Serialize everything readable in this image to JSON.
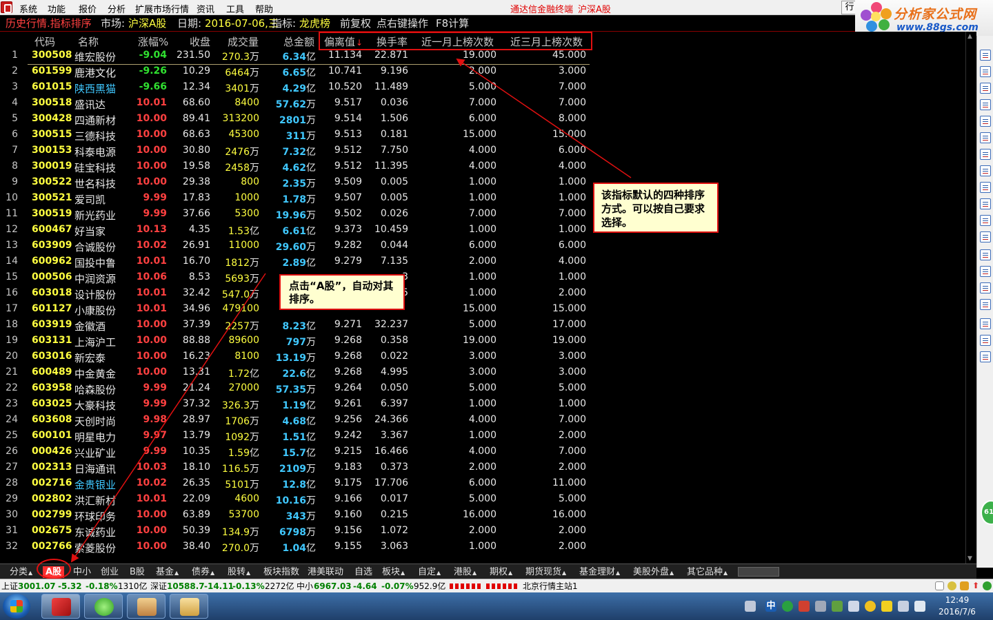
{
  "menu": {
    "items": [
      "系统",
      "功能",
      "报价",
      "分析",
      "扩展市场行情",
      "资讯",
      "工具",
      "帮助"
    ],
    "right_links": [
      "通达信金融终端",
      "沪深A股"
    ],
    "button_label": "行"
  },
  "logo": {
    "title": "分析家公式网",
    "url": "www.88gs.com"
  },
  "titlebar": {
    "page": "历史行情.指标排序",
    "market_label": "市场:",
    "market": "沪深A股",
    "date_label": "日期:",
    "date": "2016-07-06,三",
    "indicator_label": "指标:",
    "indicator": "龙虎榜",
    "adjust": "前复权",
    "right_click": "点右键操作",
    "f8": "F8计算"
  },
  "table": {
    "headers": {
      "code": "代码",
      "name": "名称",
      "change": "涨幅%",
      "close": "收盘",
      "volume": "成交量",
      "amount": "总金额",
      "deviation": "偏离值",
      "sort_arrow": "↓",
      "turnover": "换手率",
      "month1": "近一月上榜次数",
      "month3": "近三月上榜次数"
    },
    "rows": [
      {
        "idx": "1",
        "code": "300508",
        "name": "维宏股份",
        "chg": "-9.04",
        "close": "231.50",
        "vol": "270.3",
        "vol_unit": "万",
        "amt": "6.34",
        "amt_unit": "亿",
        "dev": "11.134",
        "turn": "22.871",
        "m1": "19.000",
        "m3": "45.000"
      },
      {
        "idx": "2",
        "code": "601599",
        "name": "鹿港文化",
        "chg": "-9.26",
        "close": "10.29",
        "vol": "6464",
        "vol_unit": "万",
        "amt": "6.65",
        "amt_unit": "亿",
        "dev": "10.741",
        "turn": "9.196",
        "m1": "2.000",
        "m3": "3.000"
      },
      {
        "idx": "3",
        "code": "601015",
        "name": "陕西黑猫",
        "chg": "-9.66",
        "close": "12.34",
        "vol": "3401",
        "vol_unit": "万",
        "amt": "4.29",
        "amt_unit": "亿",
        "dev": "10.520",
        "turn": "11.489",
        "m1": "5.000",
        "m3": "7.000"
      },
      {
        "idx": "4",
        "code": "300518",
        "name": "盛讯达",
        "chg": "10.01",
        "close": "68.60",
        "vol": "8400",
        "vol_unit": "",
        "amt": "57.62",
        "amt_unit": "万",
        "dev": "9.517",
        "turn": "0.036",
        "m1": "7.000",
        "m3": "7.000"
      },
      {
        "idx": "5",
        "code": "300428",
        "name": "四通新材",
        "chg": "10.00",
        "close": "89.41",
        "vol": "313200",
        "vol_unit": "",
        "amt": "2801",
        "amt_unit": "万",
        "dev": "9.514",
        "turn": "1.506",
        "m1": "6.000",
        "m3": "8.000"
      },
      {
        "idx": "6",
        "code": "300515",
        "name": "三德科技",
        "chg": "10.00",
        "close": "68.63",
        "vol": "45300",
        "vol_unit": "",
        "amt": "311",
        "amt_unit": "万",
        "dev": "9.513",
        "turn": "0.181",
        "m1": "15.000",
        "m3": "15.000"
      },
      {
        "idx": "7",
        "code": "300153",
        "name": "科泰电源",
        "chg": "10.00",
        "close": "30.80",
        "vol": "2476",
        "vol_unit": "万",
        "amt": "7.32",
        "amt_unit": "亿",
        "dev": "9.512",
        "turn": "7.750",
        "m1": "4.000",
        "m3": "6.000"
      },
      {
        "idx": "8",
        "code": "300019",
        "name": "硅宝科技",
        "chg": "10.00",
        "close": "19.58",
        "vol": "2458",
        "vol_unit": "万",
        "amt": "4.62",
        "amt_unit": "亿",
        "dev": "9.512",
        "turn": "11.395",
        "m1": "4.000",
        "m3": "4.000"
      },
      {
        "idx": "9",
        "code": "300522",
        "name": "世名科技",
        "chg": "10.00",
        "close": "29.38",
        "vol": "800",
        "vol_unit": "",
        "amt": "2.35",
        "amt_unit": "万",
        "dev": "9.509",
        "turn": "0.005",
        "m1": "1.000",
        "m3": "1.000"
      },
      {
        "idx": "10",
        "code": "300521",
        "name": "爱司凯",
        "chg": "9.99",
        "close": "17.83",
        "vol": "1000",
        "vol_unit": "",
        "amt": "1.78",
        "amt_unit": "万",
        "dev": "9.507",
        "turn": "0.005",
        "m1": "1.000",
        "m3": "1.000"
      },
      {
        "idx": "11",
        "code": "300519",
        "name": "新光药业",
        "chg": "9.99",
        "close": "37.66",
        "vol": "5300",
        "vol_unit": "",
        "amt": "19.96",
        "amt_unit": "万",
        "dev": "9.502",
        "turn": "0.026",
        "m1": "7.000",
        "m3": "7.000"
      },
      {
        "idx": "12",
        "code": "600467",
        "name": "好当家",
        "chg": "10.13",
        "close": "4.35",
        "vol": "1.53",
        "vol_unit": "亿",
        "amt": "6.61",
        "amt_unit": "亿",
        "dev": "9.373",
        "turn": "10.459",
        "m1": "1.000",
        "m3": "1.000"
      },
      {
        "idx": "13",
        "code": "603909",
        "name": "合诚股份",
        "chg": "10.02",
        "close": "26.91",
        "vol": "11000",
        "vol_unit": "",
        "amt": "29.60",
        "amt_unit": "万",
        "dev": "9.282",
        "turn": "0.044",
        "m1": "6.000",
        "m3": "6.000"
      },
      {
        "idx": "14",
        "code": "600962",
        "name": "国投中鲁",
        "chg": "10.01",
        "close": "16.70",
        "vol": "1812",
        "vol_unit": "万",
        "amt": "2.89",
        "amt_unit": "亿",
        "dev": "9.279",
        "turn": "7.135",
        "m1": "2.000",
        "m3": "4.000"
      },
      {
        "idx": "15",
        "code": "000506",
        "name": "中润资源",
        "chg": "10.06",
        "close": "8.53",
        "vol": "5693",
        "vol_unit": "万",
        "amt": "",
        "amt_unit": "",
        "dev": "",
        "turn": "3",
        "m1": "1.000",
        "m3": "1.000"
      },
      {
        "idx": "16",
        "code": "603018",
        "name": "设计股份",
        "chg": "10.01",
        "close": "32.42",
        "vol": "547.0",
        "vol_unit": "万",
        "amt": "",
        "amt_unit": "",
        "dev": "",
        "turn": "5",
        "m1": "1.000",
        "m3": "2.000"
      },
      {
        "idx": "17",
        "code": "601127",
        "name": "小康股份",
        "chg": "10.01",
        "close": "34.96",
        "vol": "479100",
        "vol_unit": "",
        "amt": "",
        "amt_unit": "",
        "dev": "",
        "turn": "",
        "m1": "15.000",
        "m3": "15.000"
      },
      {
        "idx": "18",
        "code": "603919",
        "name": "金徽酒",
        "chg": "10.00",
        "close": "37.39",
        "vol": "2257",
        "vol_unit": "万",
        "amt": "8.23",
        "amt_unit": "亿",
        "dev": "9.271",
        "turn": "32.237",
        "m1": "5.000",
        "m3": "17.000"
      },
      {
        "idx": "19",
        "code": "603131",
        "name": "上海沪工",
        "chg": "10.00",
        "close": "88.88",
        "vol": "89600",
        "vol_unit": "",
        "amt": "797",
        "amt_unit": "万",
        "dev": "9.268",
        "turn": "0.358",
        "m1": "19.000",
        "m3": "19.000"
      },
      {
        "idx": "20",
        "code": "603016",
        "name": "新宏泰",
        "chg": "10.00",
        "close": "16.23",
        "vol": "8100",
        "vol_unit": "",
        "amt": "13.19",
        "amt_unit": "万",
        "dev": "9.268",
        "turn": "0.022",
        "m1": "3.000",
        "m3": "3.000"
      },
      {
        "idx": "21",
        "code": "600489",
        "name": "中金黄金",
        "chg": "10.00",
        "close": "13.31",
        "vol": "1.72",
        "vol_unit": "亿",
        "amt": "22.6",
        "amt_unit": "亿",
        "dev": "9.268",
        "turn": "4.995",
        "m1": "3.000",
        "m3": "3.000"
      },
      {
        "idx": "22",
        "code": "603958",
        "name": "哈森股份",
        "chg": "9.99",
        "close": "21.24",
        "vol": "27000",
        "vol_unit": "",
        "amt": "57.35",
        "amt_unit": "万",
        "dev": "9.264",
        "turn": "0.050",
        "m1": "5.000",
        "m3": "5.000"
      },
      {
        "idx": "23",
        "code": "603025",
        "name": "大豪科技",
        "chg": "9.99",
        "close": "37.32",
        "vol": "326.3",
        "vol_unit": "万",
        "amt": "1.19",
        "amt_unit": "亿",
        "dev": "9.261",
        "turn": "6.397",
        "m1": "1.000",
        "m3": "1.000"
      },
      {
        "idx": "24",
        "code": "603608",
        "name": "天创时尚",
        "chg": "9.98",
        "close": "28.97",
        "vol": "1706",
        "vol_unit": "万",
        "amt": "4.68",
        "amt_unit": "亿",
        "dev": "9.256",
        "turn": "24.366",
        "m1": "4.000",
        "m3": "7.000"
      },
      {
        "idx": "25",
        "code": "600101",
        "name": "明星电力",
        "chg": "9.97",
        "close": "13.79",
        "vol": "1092",
        "vol_unit": "万",
        "amt": "1.51",
        "amt_unit": "亿",
        "dev": "9.242",
        "turn": "3.367",
        "m1": "1.000",
        "m3": "2.000"
      },
      {
        "idx": "26",
        "code": "000426",
        "name": "兴业矿业",
        "chg": "9.99",
        "close": "10.35",
        "vol": "1.59",
        "vol_unit": "亿",
        "amt": "15.7",
        "amt_unit": "亿",
        "dev": "9.215",
        "turn": "16.466",
        "m1": "4.000",
        "m3": "7.000"
      },
      {
        "idx": "27",
        "code": "002313",
        "name": "日海通讯",
        "chg": "10.03",
        "close": "18.10",
        "vol": "116.5",
        "vol_unit": "万",
        "amt": "2109",
        "amt_unit": "万",
        "dev": "9.183",
        "turn": "0.373",
        "m1": "2.000",
        "m3": "2.000"
      },
      {
        "idx": "28",
        "code": "002716",
        "name": "金贵银业",
        "chg": "10.02",
        "close": "26.35",
        "vol": "5101",
        "vol_unit": "万",
        "amt": "12.8",
        "amt_unit": "亿",
        "dev": "9.175",
        "turn": "17.706",
        "m1": "6.000",
        "m3": "11.000"
      },
      {
        "idx": "29",
        "code": "002802",
        "name": "洪汇新材",
        "chg": "10.01",
        "close": "22.09",
        "vol": "4600",
        "vol_unit": "",
        "amt": "10.16",
        "amt_unit": "万",
        "dev": "9.166",
        "turn": "0.017",
        "m1": "5.000",
        "m3": "5.000"
      },
      {
        "idx": "30",
        "code": "002799",
        "name": "环球印务",
        "chg": "10.00",
        "close": "63.89",
        "vol": "53700",
        "vol_unit": "",
        "amt": "343",
        "amt_unit": "万",
        "dev": "9.160",
        "turn": "0.215",
        "m1": "16.000",
        "m3": "16.000"
      },
      {
        "idx": "31",
        "code": "002675",
        "name": "东诚药业",
        "chg": "10.00",
        "close": "50.39",
        "vol": "134.9",
        "vol_unit": "万",
        "amt": "6798",
        "amt_unit": "万",
        "dev": "9.156",
        "turn": "1.072",
        "m1": "2.000",
        "m3": "2.000"
      },
      {
        "idx": "32",
        "code": "002766",
        "name": "索菱股份",
        "chg": "10.00",
        "close": "38.40",
        "vol": "270.0",
        "vol_unit": "万",
        "amt": "1.04",
        "amt_unit": "亿",
        "dev": "9.155",
        "turn": "3.063",
        "m1": "1.000",
        "m3": "2.000"
      }
    ]
  },
  "callouts": {
    "sort": "该指标默认的四种排序方式。可以按自己要求选择。",
    "tab": "点击“A股”，自动对其排序。"
  },
  "tabs": [
    {
      "label": "分类",
      "tri": "▲",
      "active": false
    },
    {
      "label": "A股",
      "tri": "",
      "active": true
    },
    {
      "label": "中小",
      "tri": "",
      "active": false
    },
    {
      "label": "创业",
      "tri": "",
      "active": false
    },
    {
      "label": "B股",
      "tri": "",
      "active": false
    },
    {
      "label": "基金",
      "tri": "▲",
      "active": false
    },
    {
      "label": "债券",
      "tri": "▲",
      "active": false
    },
    {
      "label": "股转",
      "tri": "▲",
      "active": false
    },
    {
      "label": "板块指数",
      "tri": "",
      "active": false
    },
    {
      "label": "港美联动",
      "tri": "",
      "active": false
    },
    {
      "label": "自选",
      "tri": "",
      "active": false
    },
    {
      "label": "板块",
      "tri": "▲",
      "active": false
    },
    {
      "label": "自定",
      "tri": "▲",
      "active": false
    },
    {
      "label": "港股",
      "tri": "▲",
      "active": false
    },
    {
      "label": "期权",
      "tri": "▲",
      "active": false
    },
    {
      "label": "期货现货",
      "tri": "▲",
      "active": false
    },
    {
      "label": "基金理财",
      "tri": "▲",
      "active": false
    },
    {
      "label": "美股外盘",
      "tri": "▲",
      "active": false
    },
    {
      "label": "其它品种",
      "tri": "▲",
      "active": false
    }
  ],
  "status": {
    "sh_label": "上证",
    "sh_value": "3001.07",
    "sh_change": "-5.32",
    "sh_pct": "-0.18%",
    "sh_amount": "1310亿",
    "sz_label": "深证",
    "sz_value": "10588.7",
    "sz_change": "-14.11",
    "sz_pct": "-0.13%",
    "sz_amount": "2272亿",
    "zx_label": "中小",
    "zx_value": "6967.03",
    "zx_change": "-4.64",
    "zx_pct": "-0.07%",
    "zx_amount": "952.9亿",
    "server": "北京行情主站1"
  },
  "taskbar": {
    "time": "12:49",
    "date": "2016/7/6",
    "ime": "中"
  },
  "side_badge": "61",
  "colors": {
    "up": "#ff4040",
    "down": "#30e030",
    "code": "#ffff40",
    "amount": "#40c8ff",
    "highlight": "#e01010"
  }
}
